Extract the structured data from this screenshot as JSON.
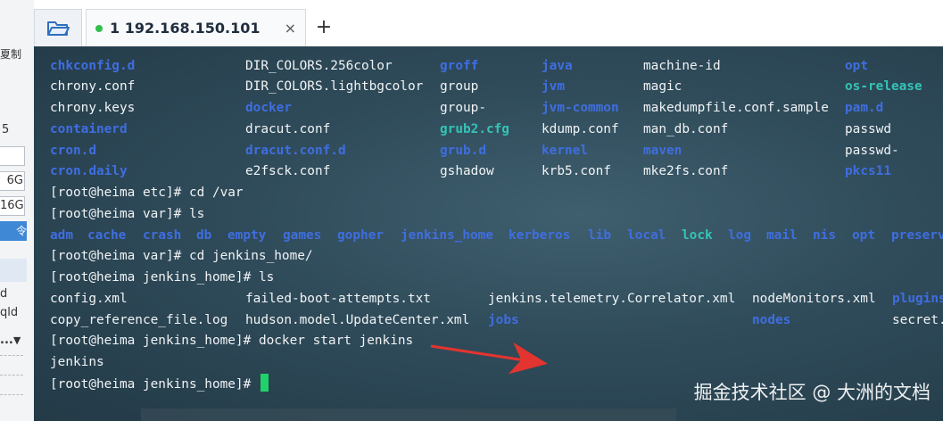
{
  "left_panel": {
    "fragments": [
      "夏制",
      "5",
      "6G",
      "16G",
      "令",
      "d",
      "qld",
      "..."
    ]
  },
  "tabs": [
    {
      "label": "1 192.168.150.101",
      "status": "connected",
      "status_color": "#2fbf4a"
    }
  ],
  "tab_close_label": "×",
  "new_tab_label": "+",
  "terminal": {
    "listing_etc": [
      [
        "chkconfig.d",
        "DIR_COLORS.256color",
        "groff",
        "java",
        "machine-id",
        "opt"
      ],
      [
        "chrony.conf",
        "DIR_COLORS.lightbgcolor",
        "group",
        "jvm",
        "magic",
        "os-release"
      ],
      [
        "chrony.keys",
        "docker",
        "group-",
        "jvm-common",
        "makedumpfile.conf.sample",
        "pam.d"
      ],
      [
        "containerd",
        "dracut.conf",
        "grub2.cfg",
        "kdump.conf",
        "man_db.conf",
        "passwd"
      ],
      [
        "cron.d",
        "dracut.conf.d",
        "grub.d",
        "kernel",
        "maven",
        "passwd-"
      ],
      [
        "cron.daily",
        "e2fsck.conf",
        "gshadow",
        "krb5.conf",
        "mke2fs.conf",
        "pkcs11"
      ]
    ],
    "prompt_cd_var": {
      "prompt": "[root@heima etc]# ",
      "command": "cd /var"
    },
    "prompt_ls_var": {
      "prompt": "[root@heima var]# ",
      "command": "ls"
    },
    "listing_var": [
      "adm",
      "cache",
      "crash",
      "db",
      "empty",
      "games",
      "gopher",
      "jenkins_home",
      "kerberos",
      "lib",
      "local",
      "lock",
      "log",
      "mail",
      "nis",
      "opt",
      "preserve"
    ],
    "prompt_cd_jh": {
      "prompt": "[root@heima var]# ",
      "command": "cd jenkins_home/"
    },
    "prompt_ls_jh": {
      "prompt": "[root@heima jenkins_home]# ",
      "command": "ls"
    },
    "listing_jh": [
      [
        "config.xml",
        "failed-boot-attempts.txt",
        "jenkins.telemetry.Correlator.xml",
        "nodeMonitors.xml",
        "plugins"
      ],
      [
        "copy_reference_file.log",
        "hudson.model.UpdateCenter.xml",
        "jobs",
        "nodes",
        "secret."
      ]
    ],
    "prompt_start": {
      "prompt": "[root@heima jenkins_home]# ",
      "command": "docker start jenkins"
    },
    "output_start": "jenkins",
    "prompt_final": {
      "prompt": "[root@heima jenkins_home]# ",
      "command": ""
    },
    "colors": {
      "text": "#f0f3f5",
      "dir": "#3f6ee0",
      "link": "#35c3b6",
      "cursor": "#1fd36a",
      "arrow": "#e3342f"
    }
  },
  "watermark": "掘金技术社区 @ 大洲的文档"
}
